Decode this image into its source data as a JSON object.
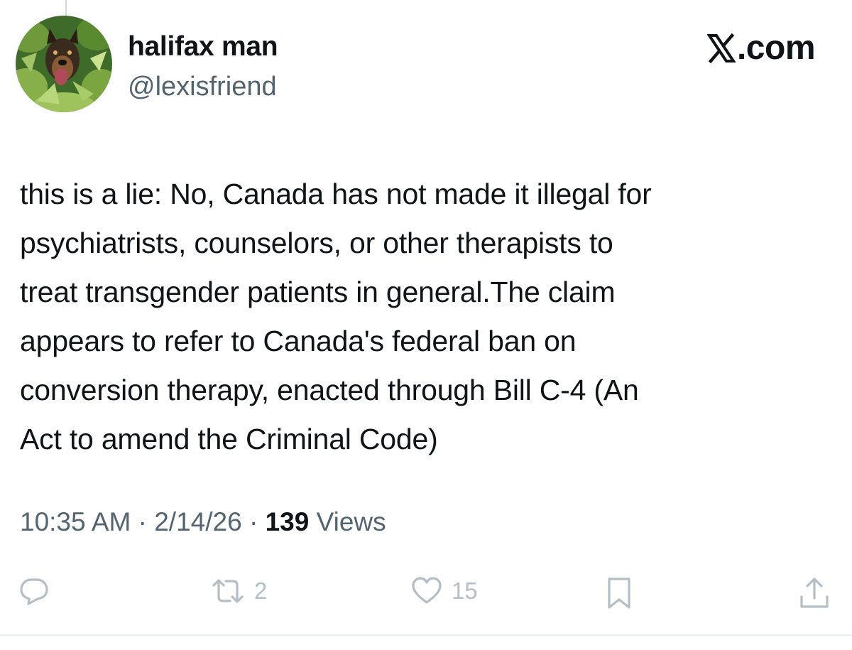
{
  "tweet": {
    "display_name": "halifax man",
    "handle": "@lexisfriend",
    "text": "this is a lie: No, Canada has not made it illegal for\npsychiatrists, counselors, or other therapists to\ntreat transgender patients in general.The claim\nappears to refer to Canada's federal ban on\nconversion therapy, enacted through Bill C-4 (An\nAct to amend the Criminal Code)",
    "time": "10:35 AM",
    "separator": "·",
    "date": "2/14/26",
    "views_count": "139",
    "views_label": "Views"
  },
  "brand": {
    "logo_icon": "x-logo-icon",
    "suffix": ".com"
  },
  "actions": {
    "reply_icon": "reply-icon",
    "retweet_icon": "retweet-icon",
    "retweet_count": "2",
    "like_icon": "heart-icon",
    "like_count": "15",
    "bookmark_icon": "bookmark-icon",
    "share_icon": "share-icon"
  },
  "colors": {
    "text_primary": "#0f1419",
    "text_secondary": "#536471",
    "action_icons": "#b4bec6",
    "background": "#ffffff"
  }
}
